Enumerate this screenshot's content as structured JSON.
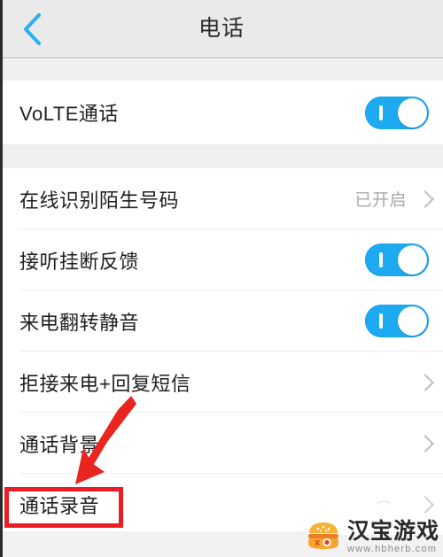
{
  "header": {
    "title": "电话",
    "back_icon": "chevron-left-icon",
    "accent_color": "#29b0f0"
  },
  "groups": [
    {
      "id": "group-volte",
      "rows": [
        {
          "id": "row-volte",
          "label": "VoLTE通话",
          "control": "toggle",
          "toggle_on": true
        }
      ]
    },
    {
      "id": "group-call-settings",
      "rows": [
        {
          "id": "row-online-id",
          "label": "在线识别陌生号码",
          "control": "value-chevron",
          "value": "已开启"
        },
        {
          "id": "row-answer-hangup-feedback",
          "label": "接听挂断反馈",
          "control": "toggle",
          "toggle_on": true
        },
        {
          "id": "row-flip-to-mute",
          "label": "来电翻转静音",
          "control": "toggle",
          "toggle_on": true
        },
        {
          "id": "row-reject-reply-sms",
          "label": "拒接来电+回复短信",
          "control": "chevron"
        },
        {
          "id": "row-call-background",
          "label": "通话背景",
          "control": "chevron"
        },
        {
          "id": "row-call-recording",
          "label": "通话录音",
          "control": "chevron",
          "highlighted": true
        }
      ]
    }
  ],
  "annotations": {
    "arrow_color": "#e8251f",
    "box_color": "#ec1c24",
    "arrow_name": "red-pointer-arrow",
    "box_name": "red-highlight-box",
    "box_target": "通话录音"
  },
  "watermark": {
    "title": "汉宝游戏",
    "url": "www.hbherb.com",
    "logo_icon": "burger-logo-icon",
    "logo_color": "#f4a72c"
  }
}
